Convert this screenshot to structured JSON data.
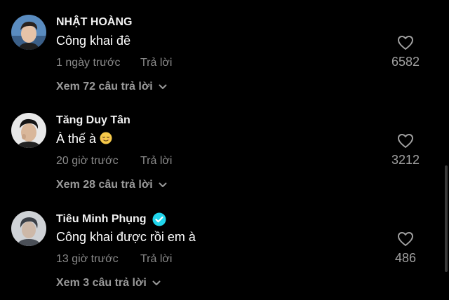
{
  "comments": [
    {
      "username": "NHẬT HOÀNG",
      "text": "Công khai đê",
      "time": "1 ngày trước",
      "reply_label": "Trả lời",
      "view_replies": "Xem 72 câu trả lời",
      "likes": "6582",
      "verified": false
    },
    {
      "username": "Tăng Duy Tân",
      "text": "À thế à",
      "emoji": "relieved-face",
      "time": "20 giờ trước",
      "reply_label": "Trả lời",
      "view_replies": "Xem 28 câu trả lời",
      "likes": "3212",
      "verified": false
    },
    {
      "username": "Tiêu Minh Phụng",
      "text": "Công khai được rồi em à",
      "time": "13 giờ trước",
      "reply_label": "Trả lời",
      "view_replies": "Xem 3 câu trả lời",
      "likes": "486",
      "verified": true
    }
  ],
  "colors": {
    "background": "#000000",
    "verified_badge": "#20d5ec",
    "secondary_text": "#8a8a8a"
  }
}
